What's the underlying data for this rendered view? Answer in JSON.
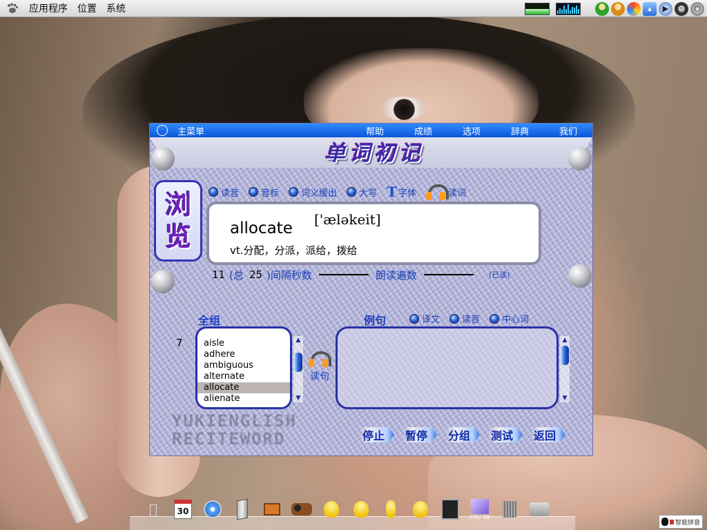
{
  "top_panel": {
    "menus": [
      "应用程序",
      "位置",
      "系统"
    ],
    "tray_icons": [
      "network-monitor",
      "cpu-monitor",
      "user-green-icon",
      "user-orange-icon",
      "swirl-icon",
      "speaker-icon",
      "media-play-icon",
      "gear-icon",
      "power-icon"
    ]
  },
  "window": {
    "main_menu_label": "主菜单",
    "menu": [
      "帮助",
      "成绩",
      "选项",
      "辞典",
      "我们"
    ],
    "logo": "单词初记",
    "mode": "浏览",
    "options": [
      "读音",
      "音标",
      "词义缓出",
      "大写",
      "字体",
      "读词"
    ],
    "current_word": {
      "word": "allocate",
      "phonetic": "['æləkeit]",
      "meaning": "vt.分配，分派，派给，拨给"
    },
    "counter": {
      "current": "11",
      "total_label": "(总",
      "total": "25",
      "interval_label": ")间隔秒数",
      "read_count_label": "朗读遍数",
      "read_status": "(已读)"
    },
    "word_list_title": "全组",
    "list_index": "7",
    "word_list": [
      "aisle",
      "adhere",
      "ambiguous",
      "alternate",
      "allocate",
      "alienate"
    ],
    "selected_word": "allocate",
    "example_title": "例句",
    "example_options": [
      "译文",
      "读音",
      "中心词"
    ],
    "read_sentence": "读句",
    "watermark": [
      "YUKIENGLISH",
      "RECITEWORD"
    ],
    "actions": [
      "停止",
      "暂停",
      "分组",
      "测试",
      "返回"
    ]
  },
  "dock": {
    "items": [
      "apple-icon",
      "calendar-icon",
      "safari-icon",
      "monitor-icon",
      "easel-icon",
      "cow-icon",
      "duck-icon",
      "duck-icon",
      "duck-icon",
      "duck-icon",
      "terminal-icon",
      "cpu-usage-icon",
      "trash-icon",
      "drive-icon"
    ],
    "calendar_day": "30",
    "cpu_label": "CPU 88"
  },
  "ime": {
    "label": "智能拼音"
  }
}
